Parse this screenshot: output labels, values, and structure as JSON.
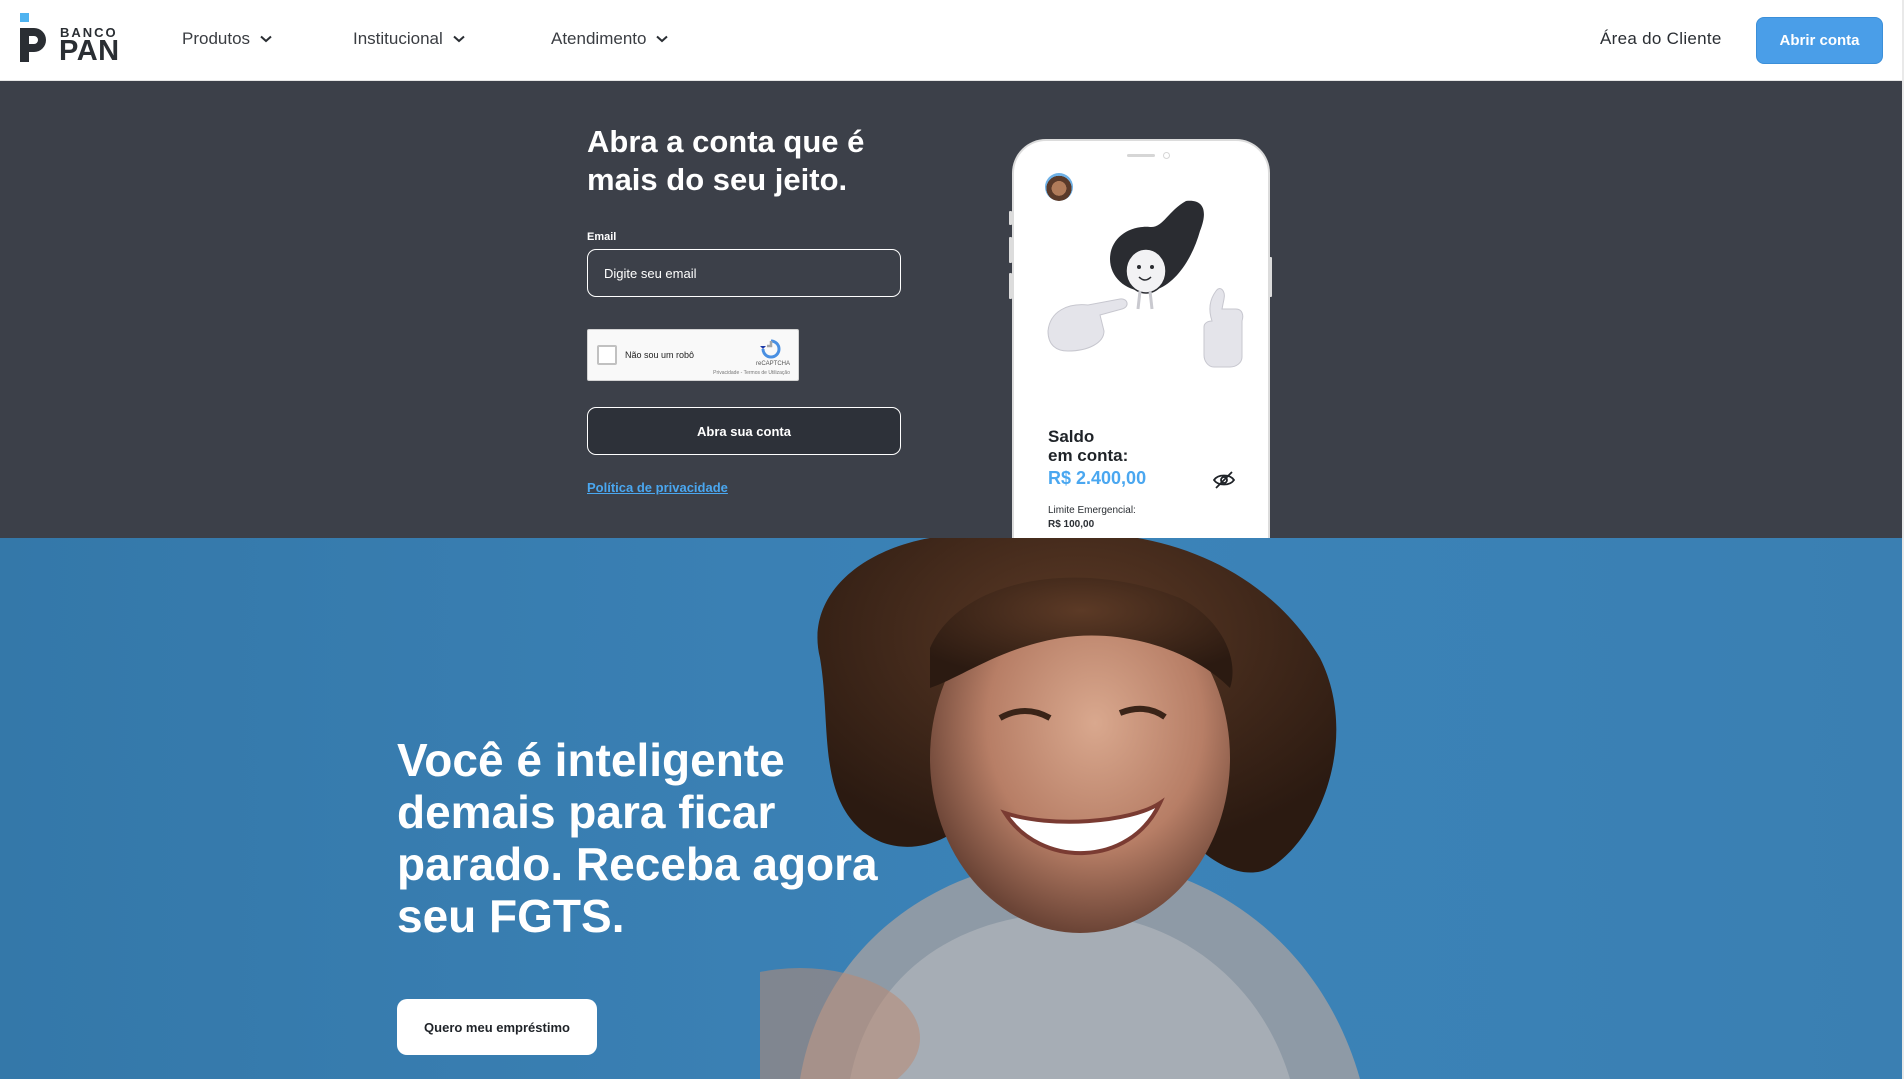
{
  "header": {
    "logo": {
      "banco": "BANCO",
      "pan": "PAN"
    },
    "nav": [
      {
        "label": "Produtos"
      },
      {
        "label": "Institucional"
      },
      {
        "label": "Atendimento"
      }
    ],
    "area_cliente": "Área do Cliente",
    "abrir_conta": "Abrir conta"
  },
  "signup": {
    "title": "Abra a conta que é mais do seu jeito.",
    "email_label": "Email",
    "email_placeholder": "Digite seu email",
    "recaptcha": {
      "label": "Não sou um robô",
      "brand": "reCAPTCHA",
      "terms": "Privacidade - Termos de Utilização"
    },
    "submit_label": "Abra sua conta",
    "privacy_link": "Política de privacidade"
  },
  "phone": {
    "saldo_label_line1": "Saldo",
    "saldo_label_line2": "em conta:",
    "saldo_value": "R$ 2.400,00",
    "limite_label": "Limite Emergencial:",
    "limite_value": "R$ 100,00"
  },
  "promo": {
    "title": "Você é inteligente demais para ficar parado. Receba agora seu FGTS.",
    "cta_label": "Quero meu empréstimo"
  },
  "colors": {
    "accent": "#4a9ee8",
    "dark_bg": "#3c4049",
    "blue_bg": "#3a80b4",
    "link": "#4aa7f0"
  }
}
